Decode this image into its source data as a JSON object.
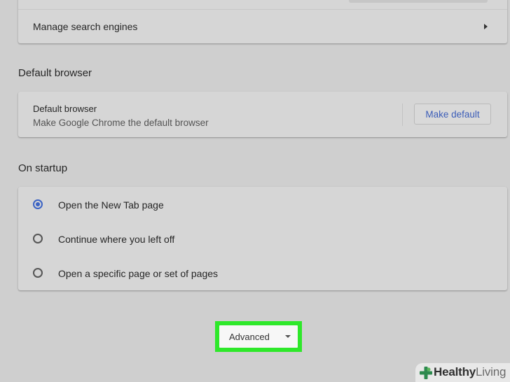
{
  "search_section": {
    "manage_label": "Manage search engines"
  },
  "default_browser_section": {
    "heading": "Default browser",
    "title": "Default browser",
    "subtitle": "Make Google Chrome the default browser",
    "button_label": "Make default"
  },
  "startup_section": {
    "heading": "On startup",
    "options": [
      {
        "label": "Open the New Tab page",
        "selected": true
      },
      {
        "label": "Continue where you left off",
        "selected": false
      },
      {
        "label": "Open a specific page or set of pages",
        "selected": false
      }
    ]
  },
  "advanced": {
    "label": "Advanced",
    "highlight_color": "#2ee82a"
  },
  "watermark": {
    "word1": "Healthy",
    "word2": "Living"
  },
  "colors": {
    "accent": "#3b63c4",
    "background": "#cfcfcf"
  }
}
